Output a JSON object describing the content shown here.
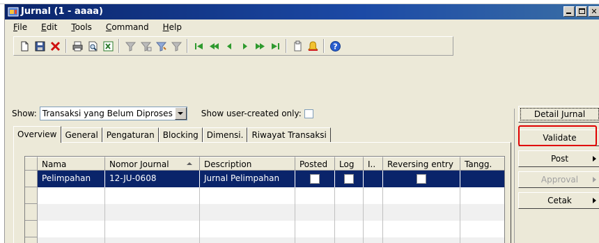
{
  "window": {
    "title": "Jurnal (1 - aaaa)"
  },
  "menu": [
    {
      "label": "File",
      "underline": "F",
      "rest": "ile"
    },
    {
      "label": "Edit",
      "underline": "E",
      "rest": "dit"
    },
    {
      "label": "Tools",
      "underline": "T",
      "rest": "ools"
    },
    {
      "label": "Command",
      "underline": "C",
      "rest": "ommand"
    },
    {
      "label": "Help",
      "underline": "H",
      "rest": "elp"
    }
  ],
  "toolbar_icons": [
    "new-icon",
    "save-icon",
    "delete-icon",
    "print-icon",
    "print-preview-icon",
    "export-excel-icon",
    "filter-icon",
    "filter-by-selection-icon",
    "advanced-filter-icon",
    "remove-filter-icon",
    "first-record-icon",
    "previous-page-icon",
    "previous-record-icon",
    "next-record-icon",
    "next-page-icon",
    "last-record-icon",
    "attach-document-icon",
    "alert-icon",
    "help-icon"
  ],
  "filter": {
    "show_label": "Show:",
    "show_value": "Transaksi yang Belum Diproses",
    "user_created_label": "Show user-created only:"
  },
  "tabs": [
    "Overview",
    "General",
    "Pengaturan",
    "Blocking",
    "Dimensi.",
    "Riwayat Transaksi"
  ],
  "grid": {
    "columns": [
      "Nama",
      "Nomor Journal",
      "Description",
      "Posted",
      "Log",
      "I..",
      "Reversing entry",
      "Tangg."
    ],
    "rows": [
      {
        "nama": "Pelimpahan",
        "nomor": "12-JU-0608",
        "description": "Jurnal Pelimpahan",
        "posted": false,
        "log": false,
        "reversing": false
      }
    ]
  },
  "buttons": {
    "detail": "Detail Jurnal",
    "validate": "Validate",
    "post": "Post",
    "approval": "Approval",
    "cetak": "Cetak"
  },
  "colors": {
    "titlebar": "#0a246a",
    "selection": "#0a246a",
    "highlight": "#e00000"
  }
}
